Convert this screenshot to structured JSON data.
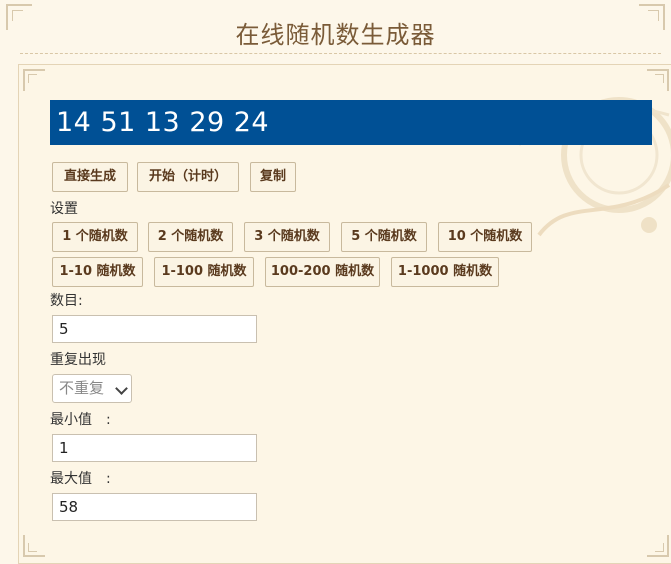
{
  "page": {
    "title": "在线随机数生成器"
  },
  "result": {
    "value": "14 51 13 29 24"
  },
  "actions": {
    "generate": "直接生成",
    "start_timed": "开始（计时）",
    "copy": "复制"
  },
  "settings": {
    "label": "设置",
    "count_presets": [
      "1 个随机数",
      "2 个随机数",
      "3 个随机数",
      "5 个随机数",
      "10 个随机数"
    ],
    "range_presets": [
      "1-10 随机数",
      "1-100 随机数",
      "100-200 随机数",
      "1-1000 随机数"
    ]
  },
  "form": {
    "count_label": "数目:",
    "count_value": "5",
    "repeat_label": "重复出现",
    "repeat_selected": "不重复",
    "min_label": "最小值　:",
    "min_value": "1",
    "max_label": "最大值　:",
    "max_value": "58"
  }
}
